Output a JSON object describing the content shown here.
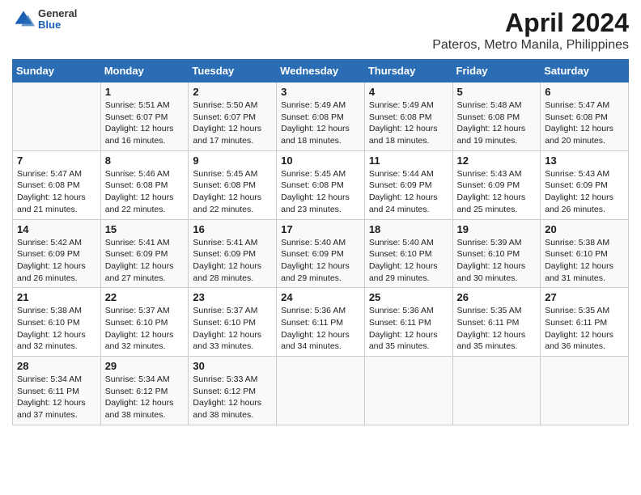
{
  "logo": {
    "general": "General",
    "blue": "Blue"
  },
  "title": "April 2024",
  "subtitle": "Pateros, Metro Manila, Philippines",
  "weekdays": [
    "Sunday",
    "Monday",
    "Tuesday",
    "Wednesday",
    "Thursday",
    "Friday",
    "Saturday"
  ],
  "weeks": [
    [
      {
        "day": "",
        "info": ""
      },
      {
        "day": "1",
        "info": "Sunrise: 5:51 AM\nSunset: 6:07 PM\nDaylight: 12 hours\nand 16 minutes."
      },
      {
        "day": "2",
        "info": "Sunrise: 5:50 AM\nSunset: 6:07 PM\nDaylight: 12 hours\nand 17 minutes."
      },
      {
        "day": "3",
        "info": "Sunrise: 5:49 AM\nSunset: 6:08 PM\nDaylight: 12 hours\nand 18 minutes."
      },
      {
        "day": "4",
        "info": "Sunrise: 5:49 AM\nSunset: 6:08 PM\nDaylight: 12 hours\nand 18 minutes."
      },
      {
        "day": "5",
        "info": "Sunrise: 5:48 AM\nSunset: 6:08 PM\nDaylight: 12 hours\nand 19 minutes."
      },
      {
        "day": "6",
        "info": "Sunrise: 5:47 AM\nSunset: 6:08 PM\nDaylight: 12 hours\nand 20 minutes."
      }
    ],
    [
      {
        "day": "7",
        "info": "Sunrise: 5:47 AM\nSunset: 6:08 PM\nDaylight: 12 hours\nand 21 minutes."
      },
      {
        "day": "8",
        "info": "Sunrise: 5:46 AM\nSunset: 6:08 PM\nDaylight: 12 hours\nand 22 minutes."
      },
      {
        "day": "9",
        "info": "Sunrise: 5:45 AM\nSunset: 6:08 PM\nDaylight: 12 hours\nand 22 minutes."
      },
      {
        "day": "10",
        "info": "Sunrise: 5:45 AM\nSunset: 6:08 PM\nDaylight: 12 hours\nand 23 minutes."
      },
      {
        "day": "11",
        "info": "Sunrise: 5:44 AM\nSunset: 6:09 PM\nDaylight: 12 hours\nand 24 minutes."
      },
      {
        "day": "12",
        "info": "Sunrise: 5:43 AM\nSunset: 6:09 PM\nDaylight: 12 hours\nand 25 minutes."
      },
      {
        "day": "13",
        "info": "Sunrise: 5:43 AM\nSunset: 6:09 PM\nDaylight: 12 hours\nand 26 minutes."
      }
    ],
    [
      {
        "day": "14",
        "info": "Sunrise: 5:42 AM\nSunset: 6:09 PM\nDaylight: 12 hours\nand 26 minutes."
      },
      {
        "day": "15",
        "info": "Sunrise: 5:41 AM\nSunset: 6:09 PM\nDaylight: 12 hours\nand 27 minutes."
      },
      {
        "day": "16",
        "info": "Sunrise: 5:41 AM\nSunset: 6:09 PM\nDaylight: 12 hours\nand 28 minutes."
      },
      {
        "day": "17",
        "info": "Sunrise: 5:40 AM\nSunset: 6:09 PM\nDaylight: 12 hours\nand 29 minutes."
      },
      {
        "day": "18",
        "info": "Sunrise: 5:40 AM\nSunset: 6:10 PM\nDaylight: 12 hours\nand 29 minutes."
      },
      {
        "day": "19",
        "info": "Sunrise: 5:39 AM\nSunset: 6:10 PM\nDaylight: 12 hours\nand 30 minutes."
      },
      {
        "day": "20",
        "info": "Sunrise: 5:38 AM\nSunset: 6:10 PM\nDaylight: 12 hours\nand 31 minutes."
      }
    ],
    [
      {
        "day": "21",
        "info": "Sunrise: 5:38 AM\nSunset: 6:10 PM\nDaylight: 12 hours\nand 32 minutes."
      },
      {
        "day": "22",
        "info": "Sunrise: 5:37 AM\nSunset: 6:10 PM\nDaylight: 12 hours\nand 32 minutes."
      },
      {
        "day": "23",
        "info": "Sunrise: 5:37 AM\nSunset: 6:10 PM\nDaylight: 12 hours\nand 33 minutes."
      },
      {
        "day": "24",
        "info": "Sunrise: 5:36 AM\nSunset: 6:11 PM\nDaylight: 12 hours\nand 34 minutes."
      },
      {
        "day": "25",
        "info": "Sunrise: 5:36 AM\nSunset: 6:11 PM\nDaylight: 12 hours\nand 35 minutes."
      },
      {
        "day": "26",
        "info": "Sunrise: 5:35 AM\nSunset: 6:11 PM\nDaylight: 12 hours\nand 35 minutes."
      },
      {
        "day": "27",
        "info": "Sunrise: 5:35 AM\nSunset: 6:11 PM\nDaylight: 12 hours\nand 36 minutes."
      }
    ],
    [
      {
        "day": "28",
        "info": "Sunrise: 5:34 AM\nSunset: 6:11 PM\nDaylight: 12 hours\nand 37 minutes."
      },
      {
        "day": "29",
        "info": "Sunrise: 5:34 AM\nSunset: 6:12 PM\nDaylight: 12 hours\nand 38 minutes."
      },
      {
        "day": "30",
        "info": "Sunrise: 5:33 AM\nSunset: 6:12 PM\nDaylight: 12 hours\nand 38 minutes."
      },
      {
        "day": "",
        "info": ""
      },
      {
        "day": "",
        "info": ""
      },
      {
        "day": "",
        "info": ""
      },
      {
        "day": "",
        "info": ""
      }
    ]
  ]
}
